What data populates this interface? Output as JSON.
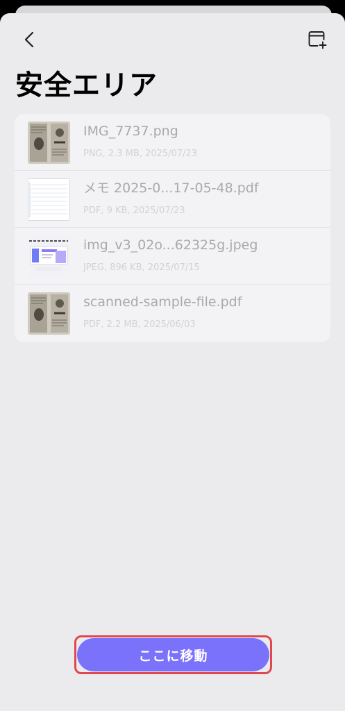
{
  "header": {
    "title": "安全エリア",
    "back_icon": "chevron-left-icon",
    "new_folder_icon": "folder-plus-icon"
  },
  "files": [
    {
      "name": "IMG_7737.png",
      "meta": "PNG, 2.3 MB, 2025/07/23",
      "thumb": "newspaper"
    },
    {
      "name": "メモ 2025-0...17-05-48.pdf",
      "meta": "PDF, 9 KB, 2025/07/23",
      "thumb": "lined-note"
    },
    {
      "name": "img_v3_02o...62325g.jpeg",
      "meta": "JPEG, 896 KB, 2025/07/15",
      "thumb": "app-banner"
    },
    {
      "name": "scanned-sample-file.pdf",
      "meta": "PDF, 2.2 MB, 2025/06/03",
      "thumb": "newspaper"
    }
  ],
  "footer": {
    "move_label": "ここに移動"
  },
  "colors": {
    "accent": "#7b72fb",
    "highlight": "#e0474f",
    "sheet_background": "#ebebed"
  }
}
